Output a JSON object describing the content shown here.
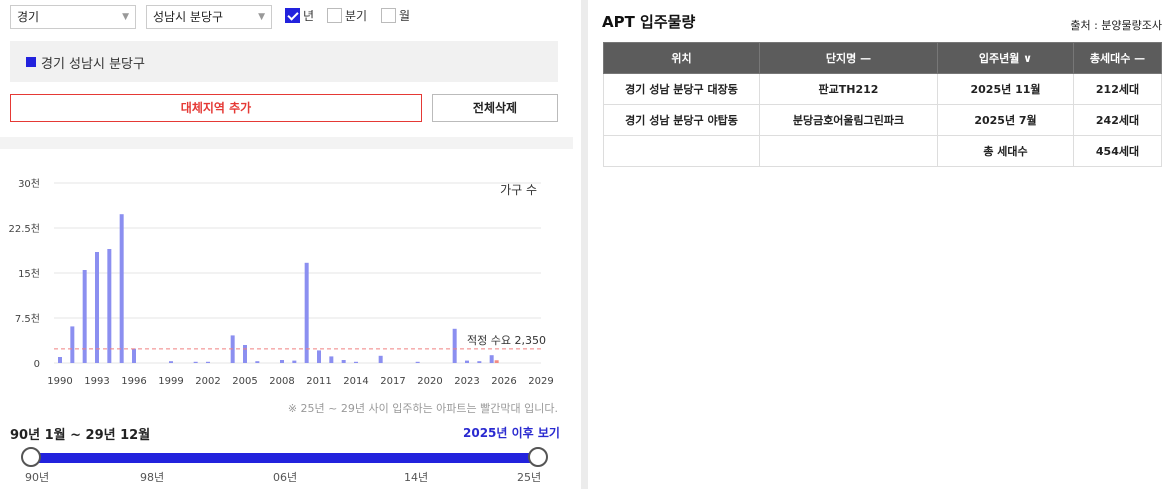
{
  "filters": {
    "province": "경기",
    "district": "성남시 분당구",
    "periods": [
      {
        "label": "년",
        "checked": true
      },
      {
        "label": "분기",
        "checked": false
      },
      {
        "label": "월",
        "checked": false
      }
    ]
  },
  "region_item": "경기 성남시 분당구",
  "buttons": {
    "add_region": "대체지역 추가",
    "delete_all": "전체삭제"
  },
  "colors": {
    "accent": "#2222dd",
    "bar": "#8b8ff0",
    "bar_future": "#f28b82",
    "threshold": "#f08080",
    "danger": "#e53935"
  },
  "chart_data": {
    "type": "bar",
    "legend": "가구 수",
    "ylim": [
      0,
      30000
    ],
    "y_ticks": [
      {
        "value": 0,
        "label": "0"
      },
      {
        "value": 7500,
        "label": "7.5천"
      },
      {
        "value": 15000,
        "label": "15천"
      },
      {
        "value": 22500,
        "label": "22.5천"
      },
      {
        "value": 30000,
        "label": "30천"
      }
    ],
    "xlim": [
      1990,
      2029
    ],
    "x_ticks": [
      "1990",
      "1993",
      "1996",
      "1999",
      "2002",
      "2005",
      "2008",
      "2011",
      "2014",
      "2017",
      "2020",
      "2023",
      "2026",
      "2029"
    ],
    "categories": [
      1990,
      1991,
      1992,
      1993,
      1994,
      1995,
      1996,
      1997,
      1998,
      1999,
      2000,
      2001,
      2002,
      2003,
      2004,
      2005,
      2006,
      2007,
      2008,
      2009,
      2010,
      2011,
      2012,
      2013,
      2014,
      2015,
      2016,
      2017,
      2018,
      2019,
      2020,
      2021,
      2022,
      2023,
      2024,
      2025
    ],
    "values": [
      1000,
      6100,
      15500,
      18500,
      19000,
      24800,
      2400,
      0,
      0,
      300,
      0,
      200,
      200,
      0,
      4600,
      3000,
      300,
      0,
      500,
      400,
      16700,
      2100,
      1100,
      500,
      200,
      0,
      1200,
      0,
      0,
      200,
      0,
      0,
      5700,
      400,
      300,
      1300
    ],
    "future_values": {
      "2025": 454
    },
    "threshold": {
      "value": 2350,
      "label": "적정 수요 2,350"
    }
  },
  "note": "※ 25년 ~ 29년 사이 입주하는 아파트는 빨간막대 입니다.",
  "period_label": "90년 1월 ~ 29년 12월",
  "after_link": "2025년 이후 보기",
  "slider": {
    "ticks": [
      "90년",
      "98년",
      "06년",
      "14년",
      "25년"
    ]
  },
  "apt": {
    "title": "APT 입주물량",
    "source": "출처 : 분양물량조사",
    "headers": [
      "위치",
      "단지명 —",
      "입주년월 ∨",
      "총세대수 —"
    ],
    "rows": [
      [
        "경기 성남 분당구 대장동",
        "판교TH212",
        "2025년 11월",
        "212세대"
      ],
      [
        "경기 성남 분당구 야탑동",
        "분당금호어울림그린파크",
        "2025년 7월",
        "242세대"
      ],
      [
        "",
        "",
        "총 세대수",
        "454세대"
      ]
    ]
  }
}
